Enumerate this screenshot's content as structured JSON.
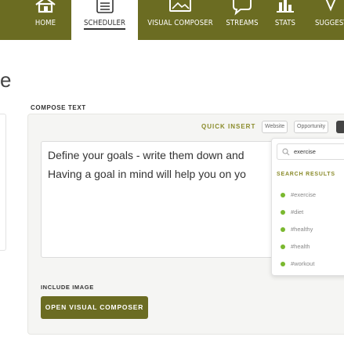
{
  "nav": {
    "items": [
      {
        "label": "HOME",
        "icon": "home-icon"
      },
      {
        "label": "SCHEDULER",
        "icon": "list-icon",
        "active": true
      },
      {
        "label": "VISUAL COMPOSER",
        "icon": "image-icon"
      },
      {
        "label": "STREAMS",
        "icon": "speech-bubble-icon"
      },
      {
        "label": "STATS",
        "icon": "bar-chart-icon"
      },
      {
        "label": "SUGGEST",
        "icon": "lightbulb-icon"
      }
    ]
  },
  "page": {
    "title": "e"
  },
  "compose": {
    "label": "COMPOSE TEXT",
    "quick_insert_label": "QUICK INSERT",
    "quick_insert_options": [
      "Website",
      "Opportunity"
    ],
    "text_line1": "Define your goals - write them down and",
    "text_line2": "Having a goal in mind will help you on yo"
  },
  "hashtag_search": {
    "value": "exercise",
    "results_heading": "SEARCH RESULTS",
    "results": [
      "#exercise",
      "#diet",
      "#healthy",
      "#health",
      "#workout"
    ]
  },
  "image": {
    "label": "INCLUDE IMAGE",
    "button_label": "OPEN VISUAL COMPOSER"
  },
  "colors": {
    "brand": "#6b6c22",
    "accent_text": "#8a8b2a",
    "result_dot": "#7ab82f"
  }
}
